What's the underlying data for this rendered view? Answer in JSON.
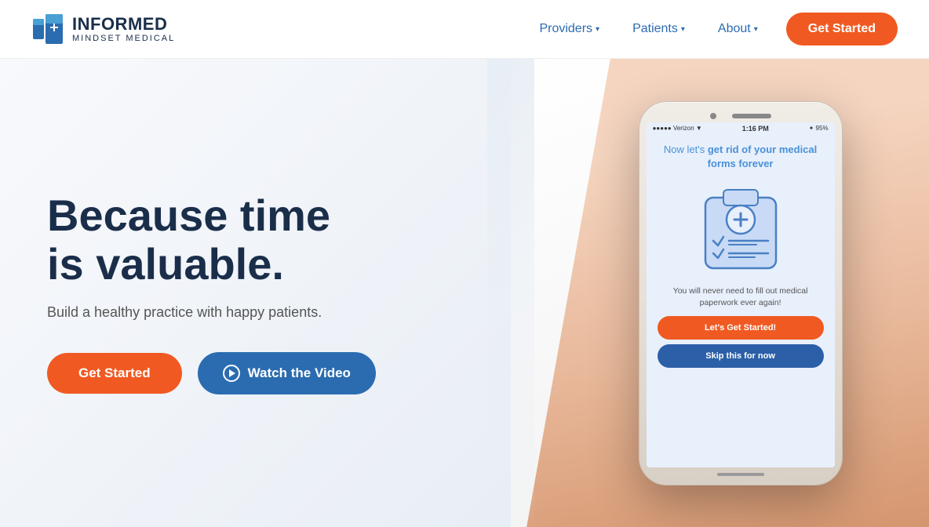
{
  "header": {
    "logo_title": "INFORMED",
    "logo_subtitle": "MINDSET MEDICAL",
    "nav": {
      "providers_label": "Providers",
      "patients_label": "Patients",
      "about_label": "About",
      "get_started_label": "Get Started"
    }
  },
  "hero": {
    "headline_line1": "Because time",
    "headline_line2": "is valuable.",
    "subtext": "Build a healthy practice with happy patients.",
    "get_started_label": "Get Started",
    "watch_video_label": "Watch the Video"
  },
  "phone": {
    "status_bar": {
      "carrier": "●●●●● Verizon ▼",
      "time": "1:16 PM",
      "battery": "✦ 95%"
    },
    "screen_headline": "Now let's get rid of your medical forms forever",
    "screen_description": "You will never need to fill out medical paperwork ever again!",
    "btn_get_started": "Let's Get Started!",
    "btn_skip": "Skip this for now"
  },
  "icons": {
    "chevron": "▾",
    "play": "▶"
  }
}
